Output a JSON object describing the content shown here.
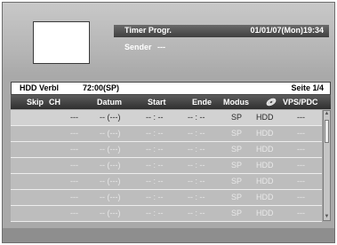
{
  "header": {
    "title": "Timer Progr.",
    "datetime": "01/01/07(Mon)19:34",
    "sender_label": "Sender",
    "sender_value": "---"
  },
  "info_bar": {
    "hdd_label": "HDD Verbl",
    "hdd_value": "72:00(SP)",
    "page": "Seite 1/4"
  },
  "columns": {
    "skip": "Skip",
    "ch": "CH",
    "datum": "Datum",
    "start": "Start",
    "ende": "Ende",
    "modus": "Modus",
    "disc_icon": "disc-icon",
    "vps": "VPS/PDC"
  },
  "rows": [
    {
      "ch": "---",
      "datum": "-- (---)",
      "start": "-- : --",
      "ende": "-- : --",
      "modus": "SP",
      "target": "HDD",
      "vps": "---"
    },
    {
      "ch": "---",
      "datum": "-- (---)",
      "start": "-- : --",
      "ende": "-- : --",
      "modus": "SP",
      "target": "HDD",
      "vps": "---"
    },
    {
      "ch": "---",
      "datum": "-- (---)",
      "start": "-- : --",
      "ende": "-- : --",
      "modus": "SP",
      "target": "HDD",
      "vps": "---"
    },
    {
      "ch": "---",
      "datum": "-- (---)",
      "start": "-- : --",
      "ende": "-- : --",
      "modus": "SP",
      "target": "HDD",
      "vps": "---"
    },
    {
      "ch": "---",
      "datum": "-- (---)",
      "start": "-- : --",
      "ende": "-- : --",
      "modus": "SP",
      "target": "HDD",
      "vps": "---"
    },
    {
      "ch": "---",
      "datum": "-- (---)",
      "start": "-- : --",
      "ende": "-- : --",
      "modus": "SP",
      "target": "HDD",
      "vps": "---"
    },
    {
      "ch": "---",
      "datum": "-- (---)",
      "start": "-- : --",
      "ende": "-- : --",
      "modus": "SP",
      "target": "HDD",
      "vps": "---"
    }
  ]
}
